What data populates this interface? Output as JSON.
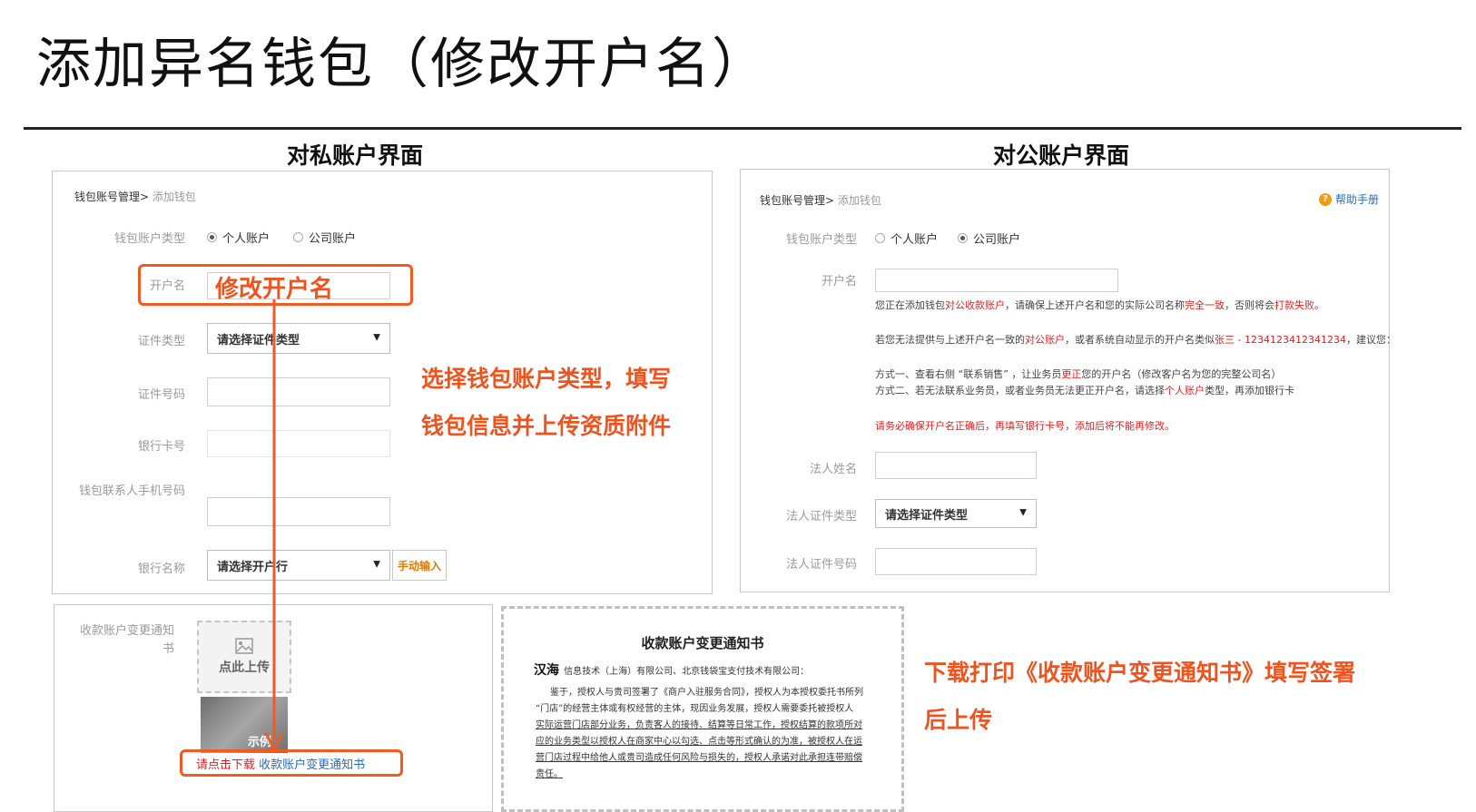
{
  "slide": {
    "title": "添加异名钱包（修改开户名）"
  },
  "private_section": {
    "title": "对私账户界面",
    "breadcrumb": {
      "parent": "钱包账号管理>",
      "current": " 添加钱包"
    },
    "account_type": {
      "label": "钱包账户类型",
      "options": [
        "个人账户",
        "公司账户"
      ],
      "selected": "个人账户"
    },
    "fields": {
      "account_name_label": "开户名",
      "id_type_label": "证件类型",
      "id_type_select": "请选择证件类型",
      "id_number_label": "证件号码",
      "bank_card_label": "银行卡号",
      "contact_phone_label": "钱包联系人手机号码",
      "bank_name_label": "银行名称",
      "bank_name_select": "请选择开户行",
      "manual_input": "手动输入"
    },
    "annotation_rename": "修改开户名",
    "annotation_fill": [
      "选择钱包账户类型，填写",
      "钱包信息并上传资质附件"
    ],
    "upload": {
      "label": "收款账户变更通知书",
      "upload_text": "点此上传",
      "sample_text": "示例"
    },
    "download": {
      "prefix": "请点击下载",
      "link": "收款账户变更通知书"
    }
  },
  "corporate_section": {
    "title": "对公账户界面",
    "breadcrumb": {
      "parent": "钱包账号管理>",
      "current": " 添加钱包"
    },
    "help": "帮助手册",
    "account_type": {
      "label": "钱包账户类型",
      "options": [
        "个人账户",
        "公司账户"
      ],
      "selected": "公司账户"
    },
    "fields": {
      "account_name_label": "开户名",
      "legal_name_label": "法人姓名",
      "legal_id_type_label": "法人证件类型",
      "legal_id_type_select": "请选择证件类型",
      "legal_id_number_label": "法人证件号码"
    },
    "notes": {
      "n1": [
        "您正在添加钱包",
        "对公收款账户",
        "，请确保上述开户名和您的实际公司名称",
        "完全一致",
        "，否则将会",
        "打款失败",
        "。"
      ],
      "n2": [
        "若您无法提供与上述开户名一致的",
        "对公账户",
        "，或者系统自动显示的开户名类似",
        "张三 - 1234123412341234",
        "，建议您："
      ],
      "n3": [
        "方式一、查看右侧 “联系销售” ，让业务员",
        "更正",
        "您的开户名（修改客户名为您的完整公司名）"
      ],
      "n4": [
        "方式二、若无法联系业务员，或者业务员无法更正开户名，请选择",
        "个人账户",
        "类型，再添加银行卡"
      ],
      "n5": "请务必确保开户名正确后，再填写银行卡号，添加后将不能再修改。"
    }
  },
  "notice_doc": {
    "title": "收款账户变更通知书",
    "signature": "汉海",
    "addressee": "信息技术（上海）有限公司、北京钱袋宝支付技术有限公司：",
    "lines": [
      "鉴于，授权人与贵司签署了《商户入驻服务合同》，授权人为本授权委托书所列",
      "“门店”的经营主体或有权经营的主体，现因业务发展，授权人需要委托被授权人",
      "实际运营门店部分业务，负责客人的接待、结算等日常工作，授权结算的款项所对",
      "应的业务类型以授权人在商家中心以勾选、点击等形式确认的为准，被授权人在运",
      "营门店过程中给他人或贵司造成任何风险与损失的，授权人承诺对此承担连带赔偿",
      "责任。"
    ]
  },
  "download_annotation": [
    "下载打印《收款账户变更通知书》填写签署",
    "后上传"
  ],
  "colors": {
    "accent_orange": "#f05a24",
    "link_blue": "#2a6db5",
    "warning_red": "#e02020"
  }
}
